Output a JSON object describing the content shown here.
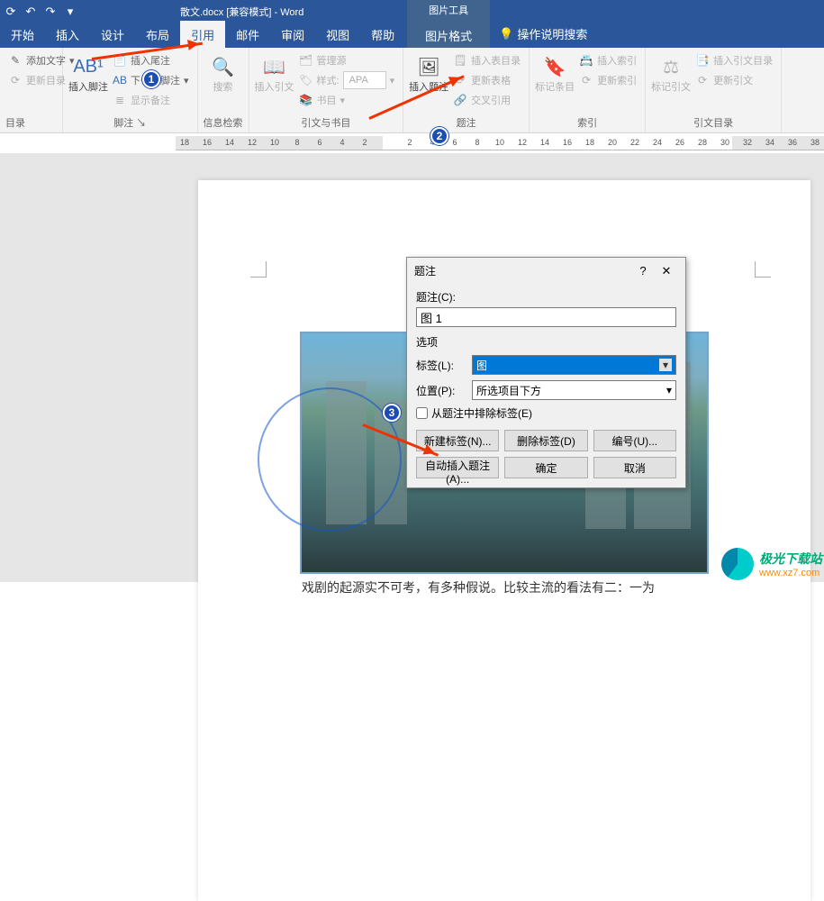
{
  "titlebar": {
    "doc_title": "散文.docx [兼容模式] - Word",
    "tool_header": "图片工具"
  },
  "tabs": {
    "start": "开始",
    "insert": "插入",
    "design": "设计",
    "layout": "布局",
    "references": "引用",
    "mailings": "邮件",
    "review": "审阅",
    "view": "视图",
    "help": "帮助",
    "picture_format": "图片格式",
    "search_hint": "操作说明搜索"
  },
  "ribbon": {
    "toc": {
      "add_text": "添加文字",
      "update_toc": "更新目录",
      "label": "目录"
    },
    "footnotes": {
      "insert_button": "插入脚注",
      "insert_endnote": "插入尾注",
      "next_footnote": "下一条脚注",
      "show_notes": "显示备注",
      "label": "脚注"
    },
    "research": {
      "search_btn": "搜索",
      "label": "信息检索"
    },
    "citations": {
      "insert_citation": "插入引文",
      "manage_sources": "管理源",
      "style_lbl": "样式:",
      "style_val": "APA",
      "bibliography": "书目",
      "label": "引文与书目"
    },
    "captions": {
      "insert_caption": "插入题注",
      "insert_tof": "插入表目录",
      "update_table": "更新表格",
      "cross_ref": "交叉引用",
      "label": "题注"
    },
    "index_group": {
      "mark_entry": "标记条目",
      "insert_index": "插入索引",
      "update_index": "更新索引",
      "label": "索引"
    },
    "toa": {
      "mark_citation": "标记引文",
      "insert_toa": "插入引文目录",
      "update_toa": "更新引文",
      "label": "引文目录"
    }
  },
  "left_pane_title": "目录",
  "ruler_numbers": [
    "18",
    "16",
    "14",
    "12",
    "10",
    "8",
    "6",
    "4",
    "2",
    "",
    "2",
    "4",
    "6",
    "8",
    "10",
    "12",
    "14",
    "16",
    "18",
    "20",
    "22",
    "24",
    "26",
    "28",
    "30",
    "32",
    "34",
    "36",
    "38"
  ],
  "document": {
    "body_text": "戏剧的起源实不可考，有多种假说。比较主流的看法有二：一为"
  },
  "dialog": {
    "title": "题注",
    "caption_lbl": "题注(C):",
    "caption_val": "图 1",
    "options_lbl": "选项",
    "label_lbl": "标签(L):",
    "label_val": "图",
    "position_lbl": "位置(P):",
    "position_val": "所选项目下方",
    "exclude_chk": "从题注中排除标签(E)",
    "new_label_btn": "新建标签(N)...",
    "delete_label_btn": "删除标签(D)",
    "numbering_btn": "编号(U)...",
    "auto_caption_btn": "自动插入题注(A)...",
    "ok_btn": "确定",
    "cancel_btn": "取消"
  },
  "badges": {
    "b1": "1",
    "b2": "2",
    "b3": "3"
  },
  "watermark": {
    "name": "极光下载站",
    "url": "www.xz7.com"
  }
}
